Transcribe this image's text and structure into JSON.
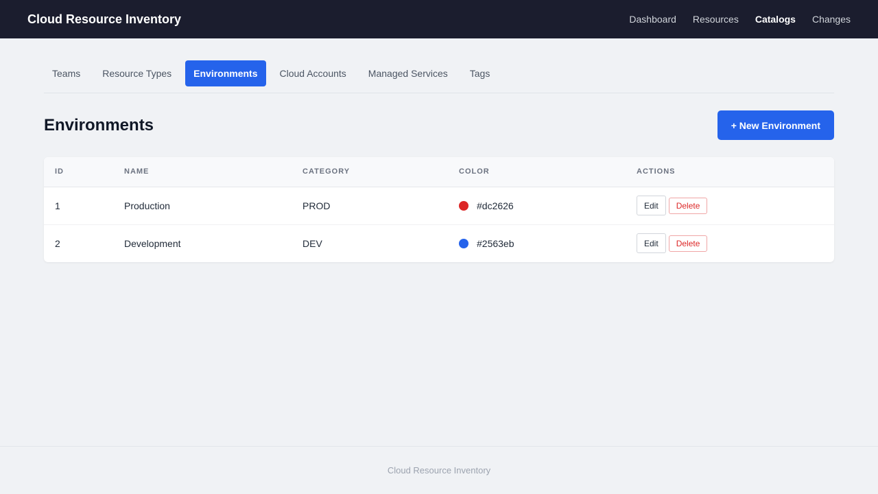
{
  "app": {
    "title": "Cloud Resource Inventory"
  },
  "topnav": {
    "items": [
      {
        "label": "Dashboard",
        "active": false
      },
      {
        "label": "Resources",
        "active": false
      },
      {
        "label": "Catalogs",
        "active": true
      },
      {
        "label": "Changes",
        "active": false
      }
    ]
  },
  "tabs": [
    {
      "label": "Teams",
      "active": false
    },
    {
      "label": "Resource Types",
      "active": false
    },
    {
      "label": "Environments",
      "active": true
    },
    {
      "label": "Cloud Accounts",
      "active": false
    },
    {
      "label": "Managed Services",
      "active": false
    },
    {
      "label": "Tags",
      "active": false
    }
  ],
  "page": {
    "title": "Environments",
    "new_button_label": "+ New Environment"
  },
  "table": {
    "columns": [
      "ID",
      "NAME",
      "CATEGORY",
      "COLOR",
      "ACTIONS"
    ],
    "rows": [
      {
        "id": "1",
        "name": "Production",
        "category": "PROD",
        "color": "#dc2626",
        "edit_label": "Edit",
        "delete_label": "Delete"
      },
      {
        "id": "2",
        "name": "Development",
        "category": "DEV",
        "color": "#2563eb",
        "edit_label": "Edit",
        "delete_label": "Delete"
      }
    ]
  },
  "footer": {
    "text": "Cloud Resource Inventory"
  },
  "colors": {
    "topbar_bg": "#1b1d2e",
    "accent": "#2563eb",
    "danger": "#dc2626",
    "page_bg": "#f0f2f5"
  }
}
